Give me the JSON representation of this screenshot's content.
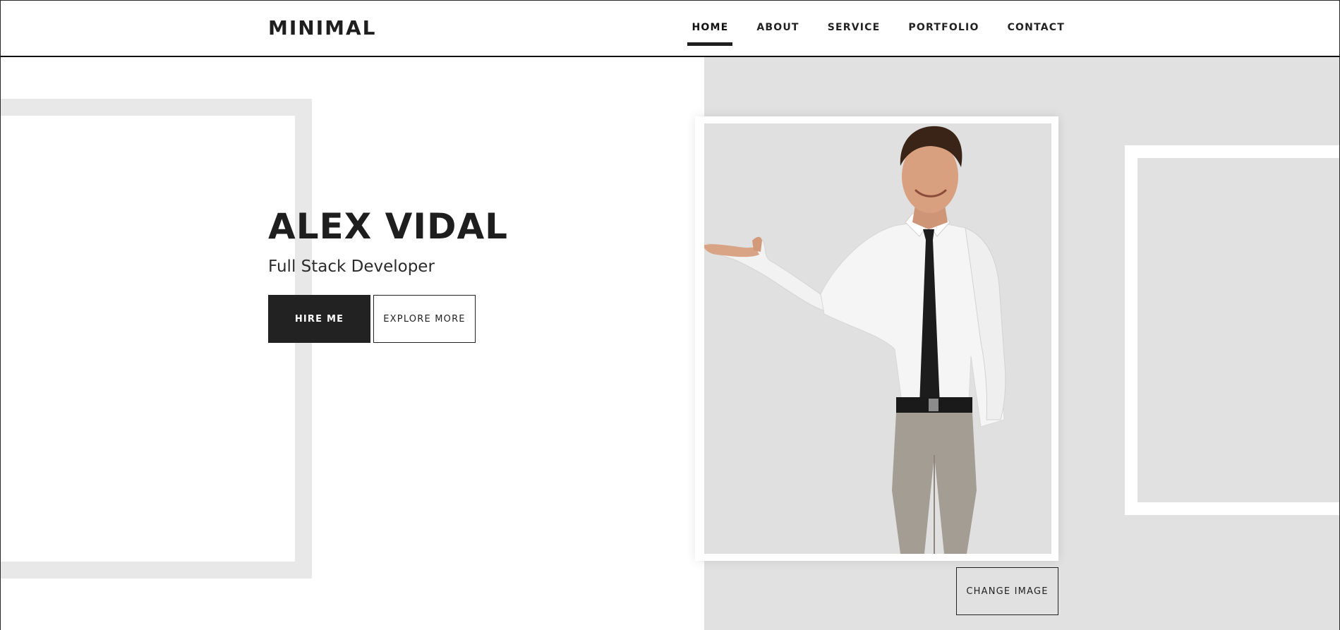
{
  "header": {
    "logo": "MINIMAL",
    "nav": [
      {
        "label": "HOME",
        "active": true
      },
      {
        "label": "ABOUT",
        "active": false
      },
      {
        "label": "SERVICE",
        "active": false
      },
      {
        "label": "PORTFOLIO",
        "active": false
      },
      {
        "label": "CONTACT",
        "active": false
      }
    ]
  },
  "hero": {
    "name": "ALEX VIDAL",
    "role": "Full Stack Developer",
    "hire_label": "HIRE ME",
    "explore_label": "EXPLORE MORE"
  },
  "photo": {
    "subject": "man-in-white-shirt-and-black-tie",
    "change_label": "CHANGE IMAGE"
  },
  "colors": {
    "dark": "#222222",
    "panel_gray": "#e1e1e1",
    "frame_gray": "#e8e8e8",
    "white": "#ffffff"
  }
}
